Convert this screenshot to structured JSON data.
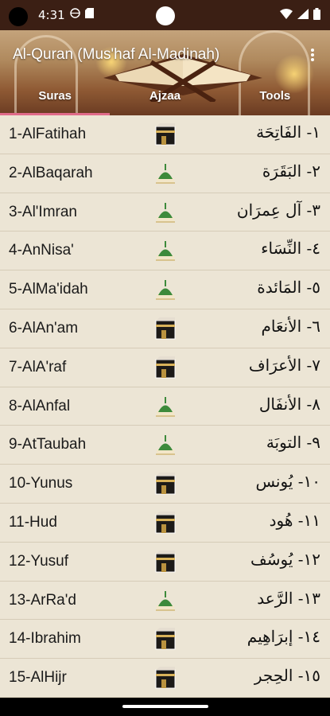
{
  "status": {
    "time": "4:31"
  },
  "header": {
    "title": "Al-Quran (Mus'haf Al-Madinah)",
    "menu_icon": "more-vert-icon"
  },
  "tabs": [
    {
      "label": "Suras",
      "active": true
    },
    {
      "label": "Ajzaa",
      "active": false
    },
    {
      "label": "Tools",
      "active": false
    }
  ],
  "suras": [
    {
      "name": "1-AlFatihah",
      "arabic": "١- الفَاتِحَة",
      "icon": "kaaba-icon"
    },
    {
      "name": "2-AlBaqarah",
      "arabic": "٢- البَقَرَة",
      "icon": "prophets-mosque-icon"
    },
    {
      "name": "3-Al'Imran",
      "arabic": "٣- آل عِمرَان",
      "icon": "prophets-mosque-icon"
    },
    {
      "name": "4-AnNisa'",
      "arabic": "٤- النِّسَاء",
      "icon": "prophets-mosque-icon"
    },
    {
      "name": "5-AlMa'idah",
      "arabic": "٥- المَائدة",
      "icon": "prophets-mosque-icon"
    },
    {
      "name": "6-AlAn'am",
      "arabic": "٦- الأنعَام",
      "icon": "kaaba-icon"
    },
    {
      "name": "7-AlA'raf",
      "arabic": "٧- الأعرَاف",
      "icon": "kaaba-icon"
    },
    {
      "name": "8-AlAnfal",
      "arabic": "٨- الأنفَال",
      "icon": "prophets-mosque-icon"
    },
    {
      "name": "9-AtTaubah",
      "arabic": "٩- التوبَة",
      "icon": "prophets-mosque-icon"
    },
    {
      "name": "10-Yunus",
      "arabic": "١٠- يُونس",
      "icon": "kaaba-icon"
    },
    {
      "name": "11-Hud",
      "arabic": "١١- هُود",
      "icon": "kaaba-icon"
    },
    {
      "name": "12-Yusuf",
      "arabic": "١٢- يُوسُف",
      "icon": "kaaba-icon"
    },
    {
      "name": "13-ArRa'd",
      "arabic": "١٣- الرَّعد",
      "icon": "prophets-mosque-icon"
    },
    {
      "name": "14-Ibrahim",
      "arabic": "١٤- إبرَاهِيم",
      "icon": "kaaba-icon"
    },
    {
      "name": "15-AlHijr",
      "arabic": "١٥- الحِجر",
      "icon": "kaaba-icon"
    }
  ]
}
